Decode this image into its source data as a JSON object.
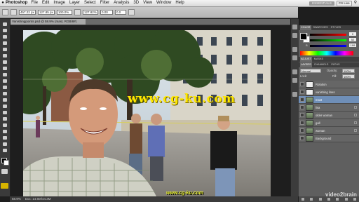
{
  "menubar": {
    "app_name": "Photoshop",
    "items": [
      "File",
      "Edit",
      "Image",
      "Layer",
      "Select",
      "Filter",
      "Analysis",
      "3D",
      "View",
      "Window",
      "Help"
    ],
    "workspace": "ESSENTIALS",
    "cs_live": "CS Live"
  },
  "options": {
    "fields": [
      "457.22 px",
      "127.85 px",
      "100.0%",
      "127.82%",
      "0.00",
      "0.0"
    ]
  },
  "document": {
    "tab_title": "Vanishingpoints.psd @ 58.9% (mast, RGB/8#)"
  },
  "status": {
    "zoom": "58.9%",
    "doc": "Doc: 14.6M/44.3M"
  },
  "canvas": {
    "overlay_text": "www.cg-ku.com"
  },
  "panels": {
    "color_tabs": [
      "COLOR",
      "SWATCHES",
      "STYLES"
    ],
    "color": {
      "r": "0",
      "g": "52",
      "b": "199"
    },
    "adjust_tabs": [
      "ADJUST",
      "MASKS"
    ],
    "layers_tabs": [
      "LAYERS",
      "CHANNELS",
      "PATHS"
    ],
    "blend_mode": "Normal",
    "opacity_label": "Opacity:",
    "opacity_value": "100%",
    "lock_label": "Lock:",
    "fill_label": "Fill:",
    "fill_value": "100%",
    "layers": [
      {
        "name": "Rotation",
        "thumb": "plain",
        "selected": false
      },
      {
        "name": "vanishing lines",
        "thumb": "plain",
        "selected": false
      },
      {
        "name": "mast",
        "thumb": "img",
        "selected": true
      },
      {
        "name": "lisa",
        "thumb": "img",
        "selected": false
      },
      {
        "name": "older woman",
        "thumb": "img",
        "selected": false
      },
      {
        "name": "gull",
        "thumb": "img",
        "selected": false
      },
      {
        "name": "woman",
        "thumb": "img",
        "selected": false
      },
      {
        "name": "Background",
        "thumb": "img",
        "selected": false
      }
    ]
  },
  "watermark": {
    "brand": "video2brain",
    "site": "www.cg-ku.com"
  }
}
